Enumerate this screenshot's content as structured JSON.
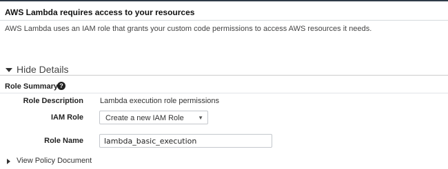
{
  "section": {
    "title": "AWS Lambda requires access to your resources",
    "intro": "AWS Lambda uses an IAM role that grants your custom code permissions to access AWS resources it needs."
  },
  "details_toggle": {
    "label": "Hide Details",
    "icon": "caret-down-icon"
  },
  "role_summary": {
    "title": "Role Summary",
    "help_icon": "question-circle-icon",
    "fields": {
      "role_description": {
        "label": "Role Description",
        "value": "Lambda execution role permissions"
      },
      "iam_role": {
        "label": "IAM Role",
        "selected": "Create a new IAM Role"
      },
      "role_name": {
        "label": "Role Name",
        "value": "lambda_basic_execution"
      }
    }
  },
  "policy_link": {
    "label": "View Policy Document",
    "icon": "caret-right-icon"
  }
}
